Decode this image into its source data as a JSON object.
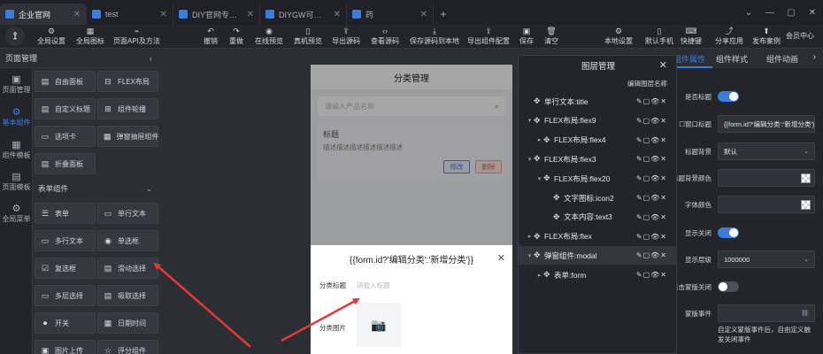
{
  "tabs": [
    {
      "title": "企业官网",
      "active": true
    },
    {
      "title": "test"
    },
    {
      "title": "DIY官网专注微信..."
    },
    {
      "title": "DIYGW可视化"
    },
    {
      "title": "药"
    }
  ],
  "toolbar": {
    "left": [
      {
        "label": "全局设置",
        "icon": "gear-icon"
      },
      {
        "label": "全局图标",
        "icon": "grid-icon"
      },
      {
        "label": "页面API及方法",
        "icon": "code-icon"
      }
    ],
    "middle": [
      {
        "label": "撤销"
      },
      {
        "label": "重做"
      },
      {
        "label": "在线预览"
      },
      {
        "label": "真机预览"
      },
      {
        "label": "导出源码"
      },
      {
        "label": "查看源码"
      },
      {
        "label": "保存源码到本地"
      },
      {
        "label": "导出组件配置"
      },
      {
        "label": "保存"
      },
      {
        "label": "清空"
      }
    ],
    "right": [
      {
        "label": "本地设置"
      },
      {
        "label": "默认手机"
      },
      {
        "label": "快捷键"
      },
      {
        "label": "分享应用"
      },
      {
        "label": "发布案例"
      }
    ],
    "user": "会员中心"
  },
  "rail": [
    {
      "label": "页面管理"
    },
    {
      "label": "基本组件",
      "active": true
    },
    {
      "label": "组件模板"
    },
    {
      "label": "页面模板"
    },
    {
      "label": "全局菜单"
    }
  ],
  "panel": {
    "title": "页面管理",
    "section_form": "表单组件",
    "basic": [
      {
        "label": "自由面板",
        "icon": "panel-icon"
      },
      {
        "label": "FLEX布局",
        "icon": "flex-icon"
      },
      {
        "label": "自定义标题",
        "icon": "title-icon"
      },
      {
        "label": "组件轮播",
        "icon": "carousel-icon"
      },
      {
        "label": "选项卡",
        "icon": "tabs-icon"
      },
      {
        "label": "弹窗抽屉组件",
        "icon": "drawer-icon"
      },
      {
        "label": "折叠面板",
        "icon": "collapse-icon"
      }
    ],
    "form": [
      {
        "label": "表单",
        "icon": "form-icon"
      },
      {
        "label": "单行文本",
        "icon": "text-icon"
      },
      {
        "label": "多行文本",
        "icon": "textarea-icon"
      },
      {
        "label": "单选框",
        "icon": "radio-icon"
      },
      {
        "label": "复选框",
        "icon": "checkbox-icon"
      },
      {
        "label": "滑动选择",
        "icon": "slider-icon"
      },
      {
        "label": "多层选择",
        "icon": "cascade-icon"
      },
      {
        "label": "吸取选择",
        "icon": "picker-icon"
      },
      {
        "label": "开关",
        "icon": "switch-icon"
      },
      {
        "label": "日期时间",
        "icon": "calendar-icon"
      },
      {
        "label": "图片上传",
        "icon": "upload-icon"
      },
      {
        "label": "评分组件",
        "icon": "star-icon"
      }
    ]
  },
  "phone": {
    "title": "分类管理",
    "search_placeholder": "请输入产品名称",
    "card_title": "标题",
    "card_desc": "描述描述描述描述描述描述",
    "edit": "修改",
    "delete": "删除",
    "modal": {
      "title": "{{form.id?'编辑分类':'新增分类'}}",
      "label_title": "分类标题",
      "placeholder_title": "请输入标题",
      "label_image": "分类图片"
    }
  },
  "layers": {
    "title": "图层管理",
    "edit_name": "编辑图层名称",
    "rows": [
      {
        "label": "单行文本:title",
        "indent": 0,
        "caret": ""
      },
      {
        "label": "FLEX布局:flex9",
        "indent": 0,
        "caret": "▾"
      },
      {
        "label": "FLEX布局:flex4",
        "indent": 1,
        "caret": "▸"
      },
      {
        "label": "FLEX布局:flex3",
        "indent": 0,
        "caret": "▾"
      },
      {
        "label": "FLEX布局:flex20",
        "indent": 1,
        "caret": "▾"
      },
      {
        "label": "文字图标:icon2",
        "indent": 2,
        "caret": ""
      },
      {
        "label": "文本内容:text3",
        "indent": 2,
        "caret": ""
      },
      {
        "label": "FLEX布局:flex",
        "indent": 0,
        "caret": "▸"
      },
      {
        "label": "弹窗组件:modal",
        "indent": 0,
        "caret": "▾",
        "selected": true
      },
      {
        "label": "表单:form",
        "indent": 1,
        "caret": "▸"
      }
    ],
    "actions": "✎▢👁✕"
  },
  "props": {
    "tabs": [
      "组件属性",
      "组件样式",
      "组件动画"
    ],
    "fields": [
      {
        "label": "是否标题",
        "type": "toggle",
        "on": true
      },
      {
        "label": "窗口标题",
        "type": "input",
        "value": "{{form.id?'编辑分类':'新增分类'}}",
        "checkbox": true
      },
      {
        "label": "标题背景",
        "type": "select",
        "value": "默认"
      },
      {
        "label": "标题背景颜色",
        "type": "color"
      },
      {
        "label": "字体颜色",
        "type": "color"
      },
      {
        "label": "显示关闭",
        "type": "toggle",
        "on": true
      },
      {
        "label": "显示层级",
        "type": "select",
        "value": "1000000"
      },
      {
        "label": "点击蒙版关闭",
        "type": "toggle",
        "on": false
      },
      {
        "label": "蒙版事件",
        "type": "link"
      }
    ],
    "note": "自定义蒙版事件后，自由定义触发关闭事件"
  },
  "colors": {
    "accent": "#3b7ddd",
    "annotation": "#e53935"
  }
}
